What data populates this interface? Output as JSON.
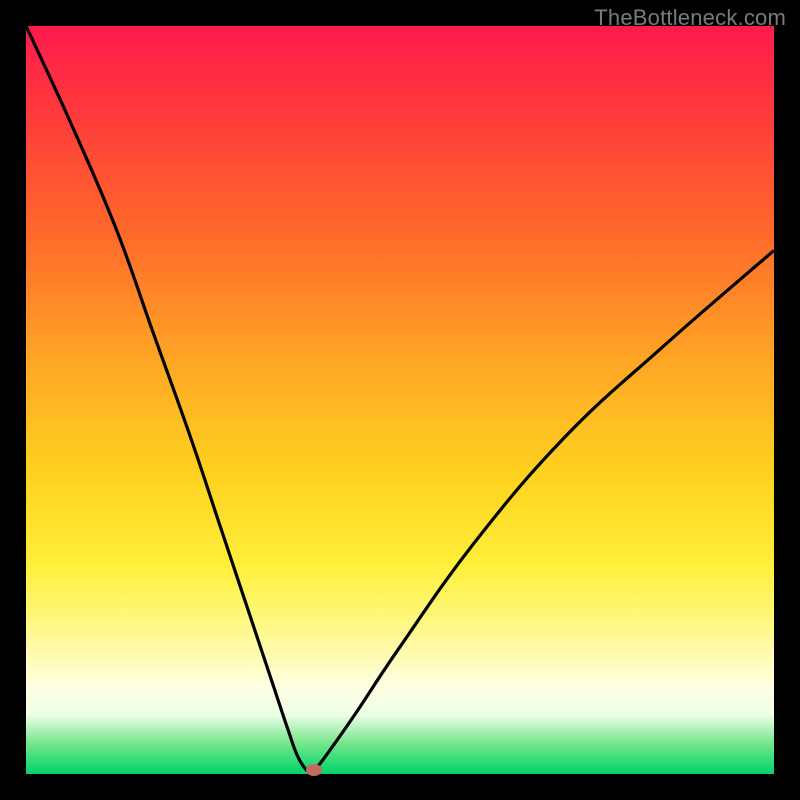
{
  "watermark": "TheBottleneck.com",
  "chart_data": {
    "type": "line",
    "title": "",
    "xlabel": "",
    "ylabel": "",
    "xlim": [
      0,
      100
    ],
    "ylim": [
      0,
      100
    ],
    "series": [
      {
        "name": "bottleneck-curve",
        "x": [
          0,
          6,
          12,
          17,
          22,
          26,
          30,
          33,
          35,
          36.5,
          38.2,
          39,
          40.5,
          44,
          50,
          60,
          72,
          85,
          100
        ],
        "values": [
          100,
          87,
          73,
          59,
          45,
          33,
          21,
          12,
          6,
          2,
          0,
          1,
          3,
          8,
          17,
          31,
          45,
          57,
          70
        ]
      }
    ],
    "marker": {
      "x": 38.5,
      "y": 0.6,
      "color": "#c46b5d"
    }
  }
}
